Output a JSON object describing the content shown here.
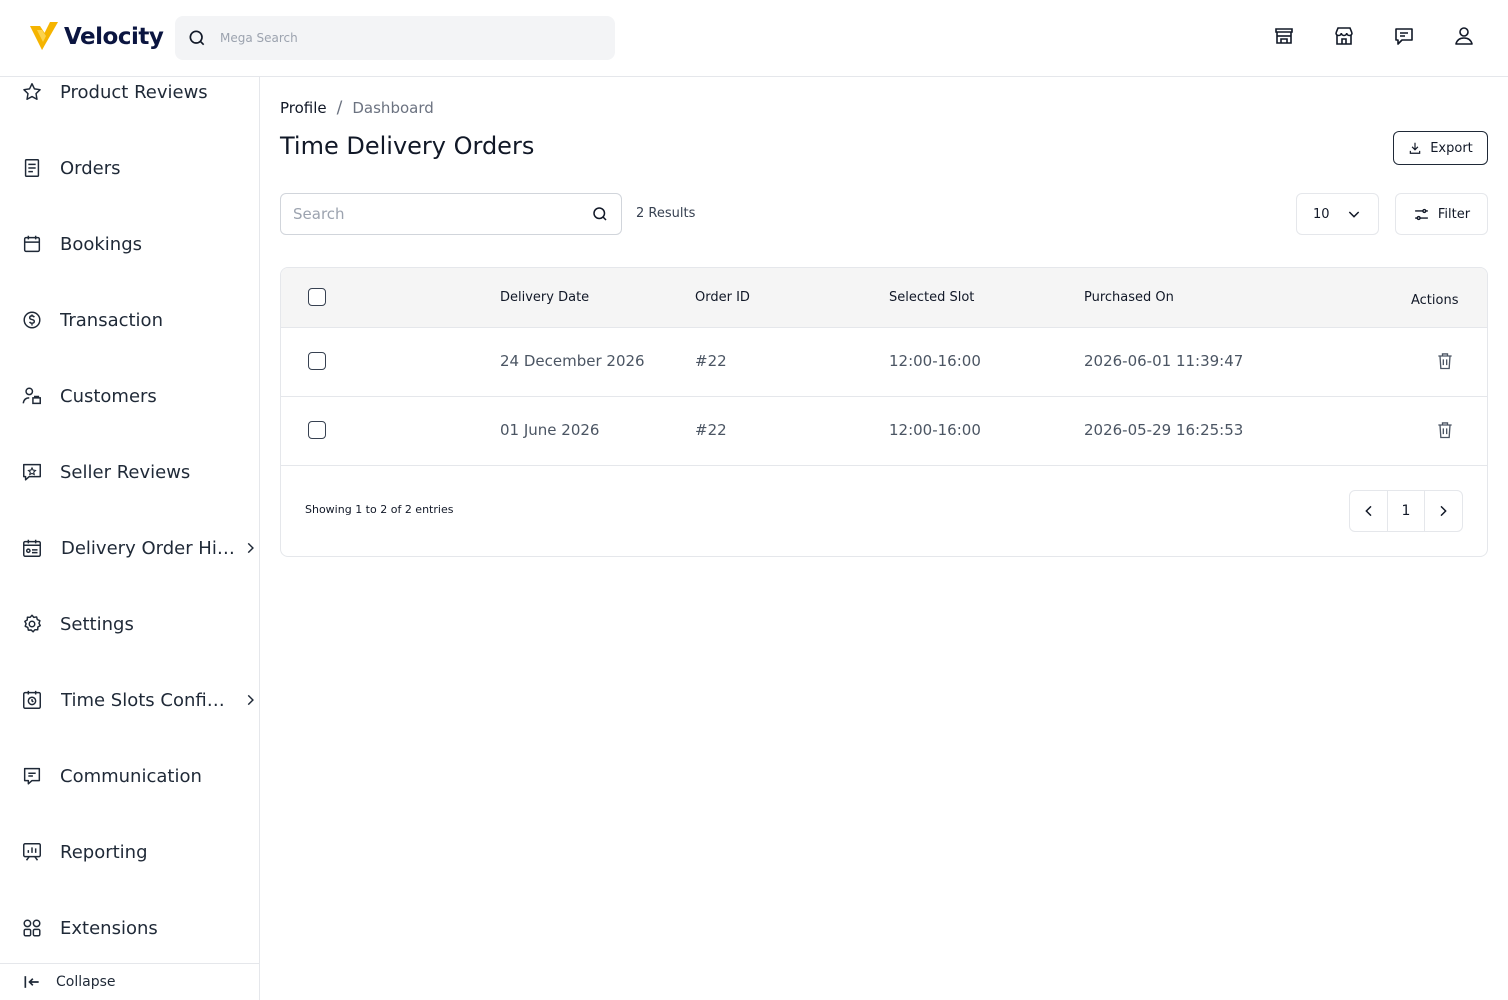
{
  "header": {
    "brand": "Velocity",
    "search_placeholder": "Mega Search",
    "icons": [
      "storefront-icon",
      "store-icon",
      "message-icon",
      "user-icon"
    ]
  },
  "sidebar": {
    "items": [
      {
        "label": "Product Reviews",
        "icon": "star-icon"
      },
      {
        "label": "Orders",
        "icon": "document-icon"
      },
      {
        "label": "Bookings",
        "icon": "calendar-icon"
      },
      {
        "label": "Transaction",
        "icon": "dollar-circle-icon"
      },
      {
        "label": "Customers",
        "icon": "users-icon"
      },
      {
        "label": "Seller Reviews",
        "icon": "review-icon"
      },
      {
        "label": "Delivery Order History",
        "icon": "delivery-calendar-icon",
        "has_children": true
      },
      {
        "label": "Settings",
        "icon": "gear-icon"
      },
      {
        "label": "Time Slots Configuration",
        "icon": "clock-calendar-icon",
        "has_children": true
      },
      {
        "label": "Communication",
        "icon": "chat-icon"
      },
      {
        "label": "Reporting",
        "icon": "presentation-chart-icon"
      },
      {
        "label": "Extensions",
        "icon": "grid-icon"
      }
    ],
    "collapse_label": "Collapse"
  },
  "breadcrumb": {
    "profile": "Profile",
    "separator": "/",
    "current": "Dashboard"
  },
  "page": {
    "title": "Time Delivery Orders",
    "export_label": "Export",
    "search_placeholder": "Search",
    "results": "2 Results",
    "per_page": "10",
    "filter_label": "Filter"
  },
  "table": {
    "columns": {
      "delivery_date": "Delivery Date",
      "order_id": "Order ID",
      "selected_slot": "Selected Slot",
      "purchased_on": "Purchased On",
      "actions": "Actions"
    },
    "rows": [
      {
        "delivery_date": "24 December 2026",
        "order_id": "#22",
        "selected_slot": "12:00-16:00",
        "purchased_on": "2026-06-01 11:39:47"
      },
      {
        "delivery_date": "01 June 2026",
        "order_id": "#22",
        "selected_slot": "12:00-16:00",
        "purchased_on": "2026-05-29 16:25:53"
      }
    ],
    "footer_text": "Showing 1 to 2 of 2 entries",
    "current_page": "1"
  },
  "colors": {
    "brand_navy": "#0b1540",
    "brand_yellow": "#f5b400",
    "header_bg": "#f5f5f5",
    "border": "#e5e7eb"
  }
}
